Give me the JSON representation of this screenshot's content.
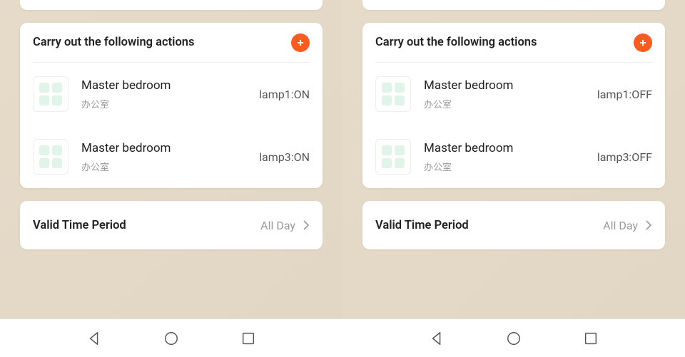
{
  "screens": [
    {
      "actions_title": "Carry out the following actions",
      "items": [
        {
          "name": "Master bedroom",
          "sub": "办公室",
          "state": "lamp1:ON"
        },
        {
          "name": "Master bedroom",
          "sub": "办公室",
          "state": "lamp3:ON"
        }
      ],
      "valid_label": "Valid Time Period",
      "valid_value": "All Day"
    },
    {
      "actions_title": "Carry out the following actions",
      "items": [
        {
          "name": "Master bedroom",
          "sub": "办公室",
          "state": "lamp1:OFF"
        },
        {
          "name": "Master bedroom",
          "sub": "办公室",
          "state": "lamp3:OFF"
        }
      ],
      "valid_label": "Valid Time Period",
      "valid_value": "All Day"
    }
  ]
}
